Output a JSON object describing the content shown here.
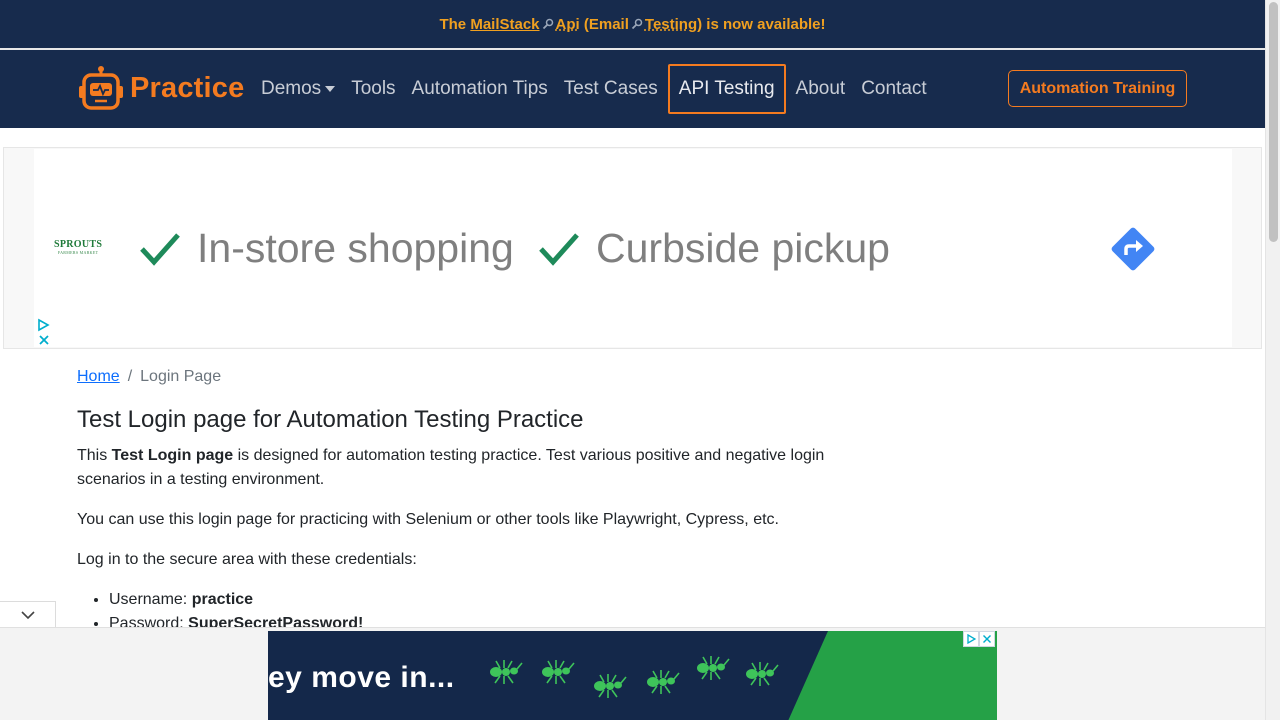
{
  "announcement": {
    "prefix": "The",
    "mailstack": "MailStack",
    "api": "Api",
    "email_open": "(Email",
    "testing": "Testing",
    "suffix": ") is now available!"
  },
  "navbar": {
    "brand": "Practice",
    "items": [
      {
        "label": "Demos",
        "has_caret": true
      },
      {
        "label": "Tools"
      },
      {
        "label": "Automation Tips"
      },
      {
        "label": "Test Cases"
      },
      {
        "label": "API Testing",
        "active": true
      },
      {
        "label": "About"
      },
      {
        "label": "Contact"
      }
    ],
    "training_button": "Automation Training"
  },
  "ad": {
    "brand_logo": "SPROUTS",
    "brand_sub": "FARMERS MARKET",
    "feature_1": "In-store shopping",
    "feature_2": "Curbside pickup",
    "icons": [
      "check-icon",
      "directions-icon",
      "adchoices-icon",
      "close-icon"
    ]
  },
  "breadcrumb": {
    "home": "Home",
    "separator": "/",
    "current": "Login Page"
  },
  "main": {
    "title": "Test Login page for Automation Testing Practice",
    "intro_pre": "This ",
    "intro_bold": "Test Login page",
    "intro_post": " is designed for automation testing practice. Test various positive and negative login scenarios in a testing environment.",
    "tools_text": "You can use this login page for practicing with Selenium or other tools like Playwright, Cypress, etc.",
    "credentials_intro": "Log in to the secure area with these credentials:",
    "username_label": "Username: ",
    "username_value": "practice",
    "password_label": "Password: ",
    "password_value": "SuperSecretPassword!"
  },
  "bottom_ad": {
    "headline": "ey move in..."
  },
  "colors": {
    "navy": "#172b4d",
    "orange": "#f47b20",
    "link": "#0d6efd"
  }
}
